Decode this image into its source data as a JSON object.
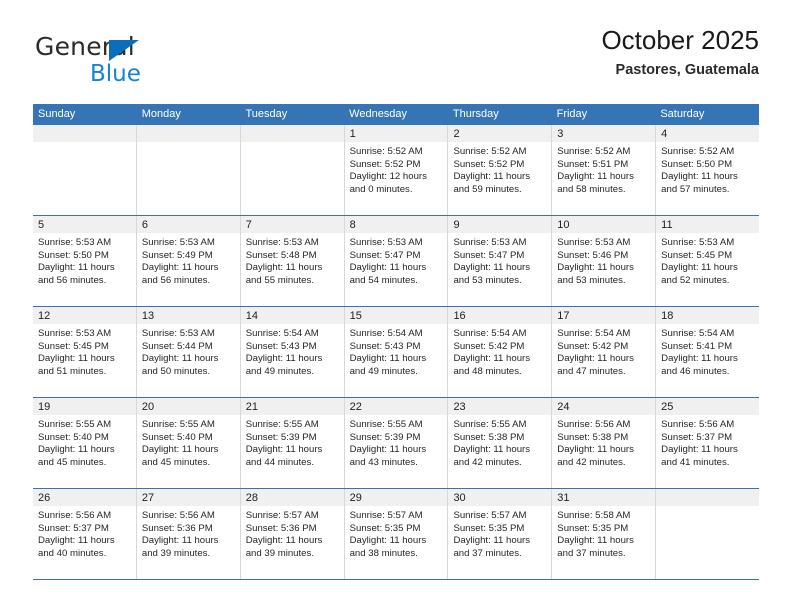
{
  "brand": {
    "name_part1": "General",
    "name_part2": "Blue",
    "triangle_icon": "brand-triangle-icon",
    "colors": {
      "general": "#2b2b2b",
      "blue": "#1683d2",
      "triangle": "#0a6ebd"
    }
  },
  "header": {
    "title": "October 2025",
    "subtitle": "Pastores, Guatemala"
  },
  "theme": {
    "header_bar": "#3575b5",
    "row_divider": "#3575b5",
    "daynum_bg": "#f0f0f0",
    "cell_border": "#d8d8d8",
    "text": "#262626"
  },
  "calendar": {
    "weekdays": [
      "Sunday",
      "Monday",
      "Tuesday",
      "Wednesday",
      "Thursday",
      "Friday",
      "Saturday"
    ],
    "weeks": [
      [
        {
          "day": "",
          "empty": true
        },
        {
          "day": "",
          "empty": true
        },
        {
          "day": "",
          "empty": true
        },
        {
          "day": "1",
          "sunrise": "Sunrise: 5:52 AM",
          "sunset": "Sunset: 5:52 PM",
          "daylight": "Daylight: 12 hours and 0 minutes."
        },
        {
          "day": "2",
          "sunrise": "Sunrise: 5:52 AM",
          "sunset": "Sunset: 5:52 PM",
          "daylight": "Daylight: 11 hours and 59 minutes."
        },
        {
          "day": "3",
          "sunrise": "Sunrise: 5:52 AM",
          "sunset": "Sunset: 5:51 PM",
          "daylight": "Daylight: 11 hours and 58 minutes."
        },
        {
          "day": "4",
          "sunrise": "Sunrise: 5:52 AM",
          "sunset": "Sunset: 5:50 PM",
          "daylight": "Daylight: 11 hours and 57 minutes."
        }
      ],
      [
        {
          "day": "5",
          "sunrise": "Sunrise: 5:53 AM",
          "sunset": "Sunset: 5:50 PM",
          "daylight": "Daylight: 11 hours and 56 minutes."
        },
        {
          "day": "6",
          "sunrise": "Sunrise: 5:53 AM",
          "sunset": "Sunset: 5:49 PM",
          "daylight": "Daylight: 11 hours and 56 minutes."
        },
        {
          "day": "7",
          "sunrise": "Sunrise: 5:53 AM",
          "sunset": "Sunset: 5:48 PM",
          "daylight": "Daylight: 11 hours and 55 minutes."
        },
        {
          "day": "8",
          "sunrise": "Sunrise: 5:53 AM",
          "sunset": "Sunset: 5:47 PM",
          "daylight": "Daylight: 11 hours and 54 minutes."
        },
        {
          "day": "9",
          "sunrise": "Sunrise: 5:53 AM",
          "sunset": "Sunset: 5:47 PM",
          "daylight": "Daylight: 11 hours and 53 minutes."
        },
        {
          "day": "10",
          "sunrise": "Sunrise: 5:53 AM",
          "sunset": "Sunset: 5:46 PM",
          "daylight": "Daylight: 11 hours and 53 minutes."
        },
        {
          "day": "11",
          "sunrise": "Sunrise: 5:53 AM",
          "sunset": "Sunset: 5:45 PM",
          "daylight": "Daylight: 11 hours and 52 minutes."
        }
      ],
      [
        {
          "day": "12",
          "sunrise": "Sunrise: 5:53 AM",
          "sunset": "Sunset: 5:45 PM",
          "daylight": "Daylight: 11 hours and 51 minutes."
        },
        {
          "day": "13",
          "sunrise": "Sunrise: 5:53 AM",
          "sunset": "Sunset: 5:44 PM",
          "daylight": "Daylight: 11 hours and 50 minutes."
        },
        {
          "day": "14",
          "sunrise": "Sunrise: 5:54 AM",
          "sunset": "Sunset: 5:43 PM",
          "daylight": "Daylight: 11 hours and 49 minutes."
        },
        {
          "day": "15",
          "sunrise": "Sunrise: 5:54 AM",
          "sunset": "Sunset: 5:43 PM",
          "daylight": "Daylight: 11 hours and 49 minutes."
        },
        {
          "day": "16",
          "sunrise": "Sunrise: 5:54 AM",
          "sunset": "Sunset: 5:42 PM",
          "daylight": "Daylight: 11 hours and 48 minutes."
        },
        {
          "day": "17",
          "sunrise": "Sunrise: 5:54 AM",
          "sunset": "Sunset: 5:42 PM",
          "daylight": "Daylight: 11 hours and 47 minutes."
        },
        {
          "day": "18",
          "sunrise": "Sunrise: 5:54 AM",
          "sunset": "Sunset: 5:41 PM",
          "daylight": "Daylight: 11 hours and 46 minutes."
        }
      ],
      [
        {
          "day": "19",
          "sunrise": "Sunrise: 5:55 AM",
          "sunset": "Sunset: 5:40 PM",
          "daylight": "Daylight: 11 hours and 45 minutes."
        },
        {
          "day": "20",
          "sunrise": "Sunrise: 5:55 AM",
          "sunset": "Sunset: 5:40 PM",
          "daylight": "Daylight: 11 hours and 45 minutes."
        },
        {
          "day": "21",
          "sunrise": "Sunrise: 5:55 AM",
          "sunset": "Sunset: 5:39 PM",
          "daylight": "Daylight: 11 hours and 44 minutes."
        },
        {
          "day": "22",
          "sunrise": "Sunrise: 5:55 AM",
          "sunset": "Sunset: 5:39 PM",
          "daylight": "Daylight: 11 hours and 43 minutes."
        },
        {
          "day": "23",
          "sunrise": "Sunrise: 5:55 AM",
          "sunset": "Sunset: 5:38 PM",
          "daylight": "Daylight: 11 hours and 42 minutes."
        },
        {
          "day": "24",
          "sunrise": "Sunrise: 5:56 AM",
          "sunset": "Sunset: 5:38 PM",
          "daylight": "Daylight: 11 hours and 42 minutes."
        },
        {
          "day": "25",
          "sunrise": "Sunrise: 5:56 AM",
          "sunset": "Sunset: 5:37 PM",
          "daylight": "Daylight: 11 hours and 41 minutes."
        }
      ],
      [
        {
          "day": "26",
          "sunrise": "Sunrise: 5:56 AM",
          "sunset": "Sunset: 5:37 PM",
          "daylight": "Daylight: 11 hours and 40 minutes."
        },
        {
          "day": "27",
          "sunrise": "Sunrise: 5:56 AM",
          "sunset": "Sunset: 5:36 PM",
          "daylight": "Daylight: 11 hours and 39 minutes."
        },
        {
          "day": "28",
          "sunrise": "Sunrise: 5:57 AM",
          "sunset": "Sunset: 5:36 PM",
          "daylight": "Daylight: 11 hours and 39 minutes."
        },
        {
          "day": "29",
          "sunrise": "Sunrise: 5:57 AM",
          "sunset": "Sunset: 5:35 PM",
          "daylight": "Daylight: 11 hours and 38 minutes."
        },
        {
          "day": "30",
          "sunrise": "Sunrise: 5:57 AM",
          "sunset": "Sunset: 5:35 PM",
          "daylight": "Daylight: 11 hours and 37 minutes."
        },
        {
          "day": "31",
          "sunrise": "Sunrise: 5:58 AM",
          "sunset": "Sunset: 5:35 PM",
          "daylight": "Daylight: 11 hours and 37 minutes."
        },
        {
          "day": "",
          "empty": true
        }
      ]
    ]
  }
}
